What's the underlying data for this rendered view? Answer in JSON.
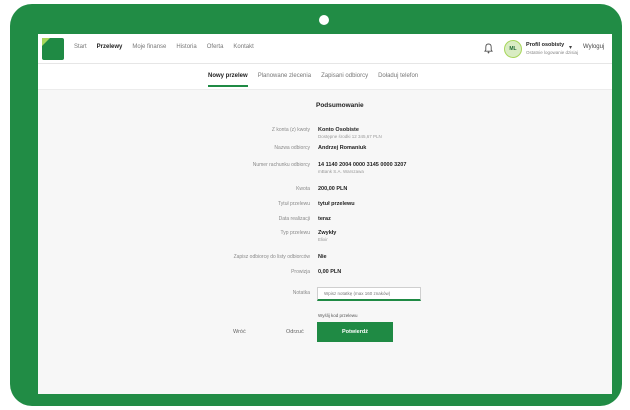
{
  "nav": {
    "items": [
      "Start",
      "Przelewy",
      "Moje finanse",
      "Historia",
      "Oferta",
      "Kontakt"
    ],
    "active_index": 1
  },
  "user": {
    "initials": "ML",
    "name": "Profil osobisty",
    "subtitle": "Ostatnie logowanie dzisiaj",
    "logout_label": "Wyloguj"
  },
  "subtabs": {
    "items": [
      "Nowy przelew",
      "Planowane zlecenia",
      "Zapisani odbiorcy",
      "Doładuj telefon"
    ],
    "active_index": 0
  },
  "summary": {
    "title": "Podsumowanie",
    "rows": [
      {
        "label": "Z konta (z) kwoty",
        "value": "Konto Osobiste",
        "sub": "Dostępne środki 12 345,67 PLN"
      },
      {
        "label": "Nazwa odbiorcy",
        "value": "Andrzej Romaniuk",
        "sub": ""
      },
      {
        "label": "Numer rachunku odbiorcy",
        "value": "14 1140 2004 0000 3145 0000 3207",
        "sub": "mBank S.A. Warszawa"
      },
      {
        "label": "Kwota",
        "value": "200,00 PLN",
        "sub": ""
      },
      {
        "label": "Tytuł przelewu",
        "value": "tytuł przelewu",
        "sub": ""
      },
      {
        "label": "Data realizacji",
        "value": "teraz",
        "sub": ""
      },
      {
        "label": "Typ przelewu",
        "value": "Zwykły",
        "sub": "Elixir"
      },
      {
        "label": "Zapisz odbiorcę do listy odbiorców",
        "value": "Nie",
        "sub": ""
      },
      {
        "label": "Prowizja",
        "value": "0,00 PLN",
        "sub": ""
      }
    ],
    "note_label": "Notatka",
    "note_placeholder": "Wpisz notatkę (max 160 znaków)"
  },
  "actions": {
    "send_hint": "Wyślij kod przelewu",
    "confirm_label": "Potwierdź",
    "back_label": "Wróć",
    "cancel_label": "Odrzuć"
  },
  "colors": {
    "brand": "#1f8a44",
    "device_frame": "#218c45",
    "accent_light": "#a7d65a"
  }
}
